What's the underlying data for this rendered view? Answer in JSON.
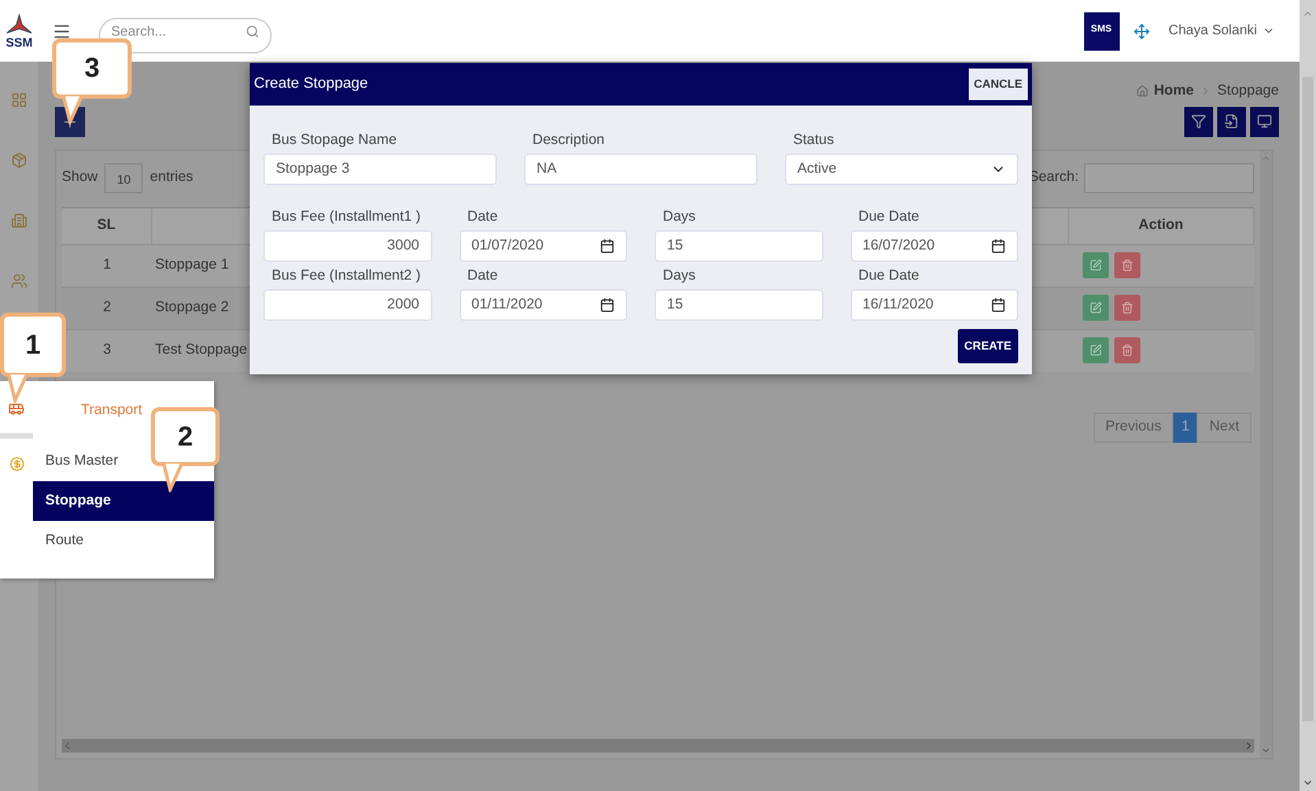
{
  "header": {
    "logo": "SSM",
    "search_placeholder": "Search...",
    "badge": "SMS",
    "user": "Chaya Solanki"
  },
  "breadcrumb": [
    "Home",
    "Stoppage"
  ],
  "table_controls": {
    "show_label": "Show",
    "page_size": "10",
    "entries_label": "entries",
    "search_label": "Search:"
  },
  "table": {
    "columns": [
      "SL",
      "",
      "Action"
    ],
    "rows": [
      {
        "sl": "1",
        "name": "Stoppage 1"
      },
      {
        "sl": "2",
        "name": "Stoppage 2"
      },
      {
        "sl": "3",
        "name": "Test Stoppage"
      }
    ]
  },
  "pagination": {
    "previous": "Previous",
    "pages": [
      {
        "label": "1",
        "selected": true
      }
    ],
    "next": "Next"
  },
  "flyout_menu": {
    "title": "Transport",
    "items": [
      {
        "label": "Bus Master",
        "selected": false
      },
      {
        "label": "Stoppage",
        "selected": true
      },
      {
        "label": "Route",
        "selected": false
      }
    ]
  },
  "modal": {
    "title": "Create Stoppage",
    "cancel": "CANCLE",
    "fields": [
      {
        "kind": "text",
        "label": "Bus Stopage Name",
        "value": "Stoppage 3"
      },
      {
        "kind": "text",
        "label": "Description",
        "value": "NA"
      },
      {
        "kind": "select",
        "label": "Status",
        "value": "Active"
      }
    ],
    "installments": [
      {
        "fee_label": "Bus Fee (Installment1 )",
        "fee": "3000",
        "date_label": "Date",
        "date": "01/07/2020",
        "days_label": "Days",
        "days": "15",
        "due_label": "Due Date",
        "due_date": "16/07/2020"
      },
      {
        "fee_label": "Bus Fee (Installment2 )",
        "fee": "2000",
        "date_label": "Date",
        "date": "01/11/2020",
        "days_label": "Days",
        "days": "15",
        "due_label": "Due Date",
        "due_date": "16/11/2020"
      }
    ],
    "submit": "CREATE"
  },
  "callouts": [
    "1",
    "2",
    "3"
  ]
}
